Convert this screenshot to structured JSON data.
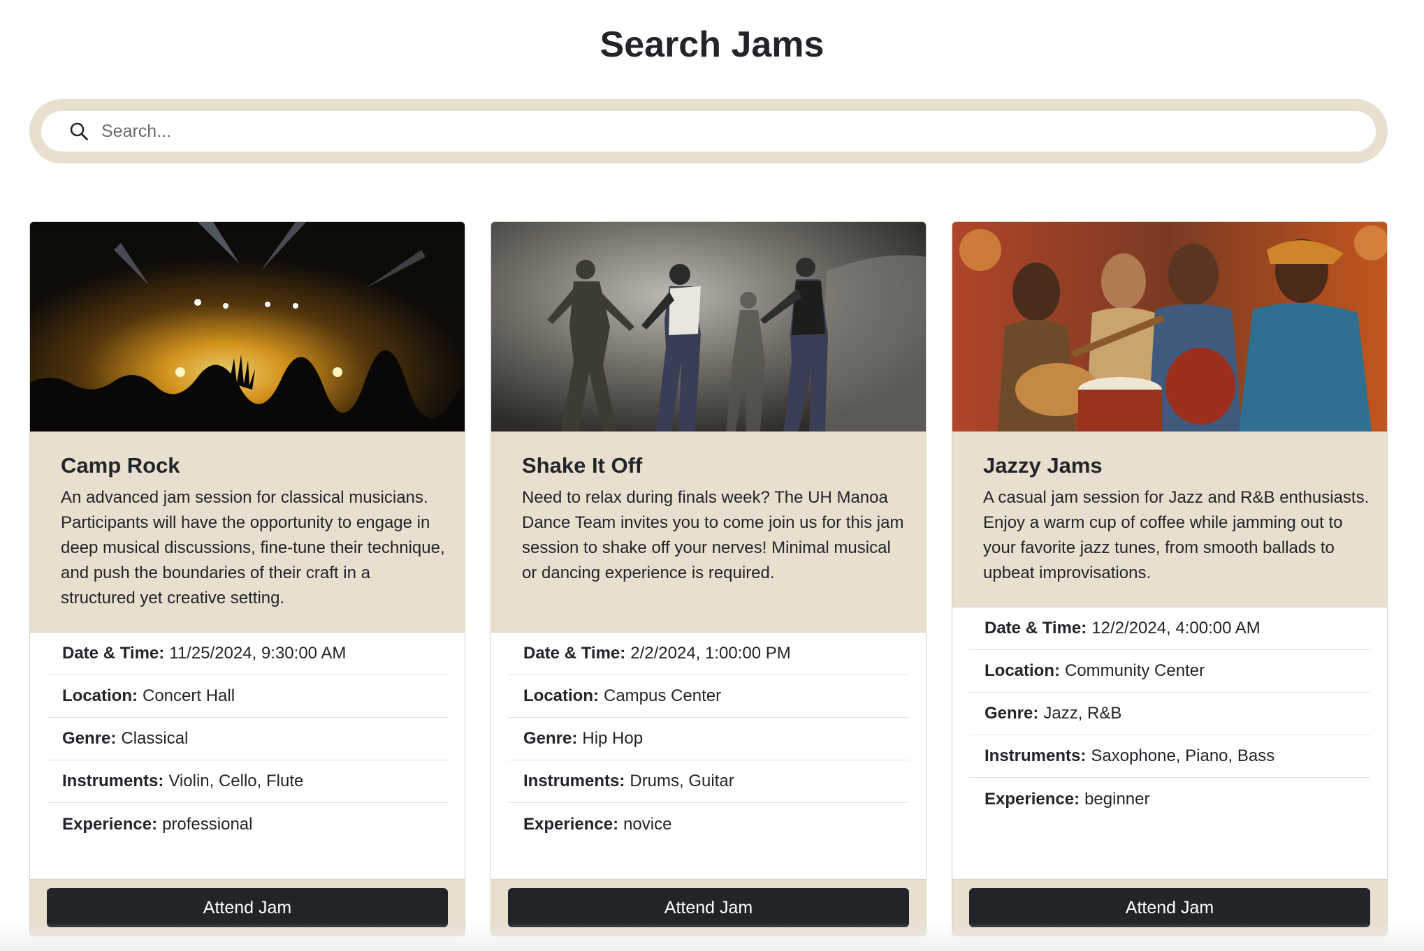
{
  "page": {
    "title": "Search Jams"
  },
  "search": {
    "placeholder": "Search..."
  },
  "labels": {
    "date_time": "Date & Time:",
    "location": "Location:",
    "genre": "Genre:",
    "instruments": "Instruments:",
    "experience": "Experience:"
  },
  "colors": {
    "panel_beige": "#e8dfcf",
    "button_dark": "#212529",
    "text": "#212529"
  },
  "cards": [
    {
      "image": "concert-crowd-photo",
      "title": "Camp Rock",
      "description": "An advanced jam session for classical musicians. Participants will have the opportunity to engage in deep musical discussions, fine-tune their technique, and push the boundaries of their craft in a structured yet creative setting.",
      "date_time": "11/25/2024, 9:30:00 AM",
      "location": "Concert Hall",
      "genre": "Classical",
      "instruments": "Violin, Cello, Flute",
      "experience": "professional",
      "button": "Attend Jam"
    },
    {
      "image": "dancers-photo",
      "title": "Shake It Off",
      "description": "Need to relax during finals week? The UH Manoa Dance Team invites you to come join us for this jam session to shake off your nerves! Minimal musical or dancing experience is required.",
      "date_time": "2/2/2024, 1:00:00 PM",
      "location": "Campus Center",
      "genre": "Hip Hop",
      "instruments": "Drums, Guitar",
      "experience": "novice",
      "button": "Attend Jam"
    },
    {
      "image": "jazz-musicians-photo",
      "title": "Jazzy Jams",
      "description": "A casual jam session for Jazz and R&B enthusiasts. Enjoy a warm cup of coffee while jamming out to your favorite jazz tunes, from smooth ballads to upbeat improvisations.",
      "date_time": "12/2/2024, 4:00:00 AM",
      "location": "Community Center",
      "genre": "Jazz, R&B",
      "instruments": "Saxophone, Piano, Bass",
      "experience": "beginner",
      "button": "Attend Jam"
    }
  ]
}
